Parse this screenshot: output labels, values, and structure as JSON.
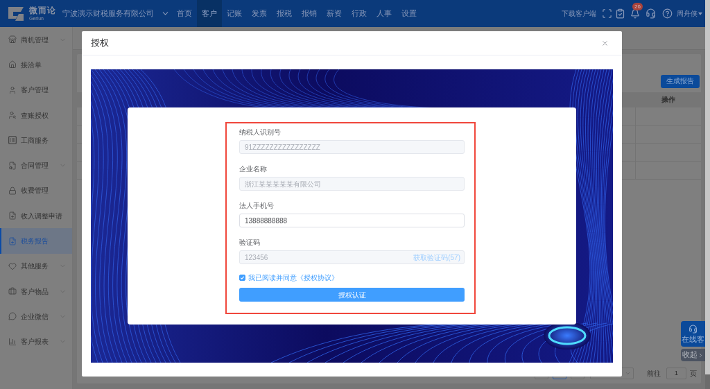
{
  "topbar": {
    "logo": {
      "name": "微而论",
      "subtitle": "Gerlun"
    },
    "company": "宁波演示财税服务有限公司",
    "nav": [
      {
        "label": "首页",
        "selected": false
      },
      {
        "label": "客户",
        "selected": true
      },
      {
        "label": "记账",
        "selected": false
      },
      {
        "label": "发票",
        "selected": false
      },
      {
        "label": "报税",
        "selected": false
      },
      {
        "label": "报销",
        "selected": false
      },
      {
        "label": "薪资",
        "selected": false
      },
      {
        "label": "行政",
        "selected": false
      },
      {
        "label": "人事",
        "selected": false
      },
      {
        "label": "设置",
        "selected": false
      }
    ],
    "download": "下载客户端",
    "notification_count": "26",
    "user": "周舟侠"
  },
  "sidebar": {
    "items": [
      {
        "label": "商机管理",
        "has_children": true,
        "selected": false
      },
      {
        "label": "接洽单",
        "has_children": false,
        "selected": false
      },
      {
        "label": "客户管理",
        "has_children": false,
        "selected": false
      },
      {
        "label": "查账授权",
        "has_children": false,
        "selected": false
      },
      {
        "label": "工商服务",
        "has_children": false,
        "selected": false
      },
      {
        "label": "合同管理",
        "has_children": true,
        "selected": false
      },
      {
        "label": "收费管理",
        "has_children": false,
        "selected": false
      },
      {
        "label": "收入调整申请",
        "has_children": false,
        "selected": false
      },
      {
        "label": "税务报告",
        "has_children": false,
        "selected": true
      },
      {
        "label": "其他服务",
        "has_children": true,
        "selected": false
      },
      {
        "label": "客户物品",
        "has_children": true,
        "selected": false
      },
      {
        "label": "企业微信",
        "has_children": true,
        "selected": false
      },
      {
        "label": "客户报表",
        "has_children": true,
        "selected": false
      }
    ]
  },
  "page": {
    "generate_button": "生成报告",
    "table": {
      "columns": [
        {
          "label": "操作"
        }
      ]
    },
    "pager": {
      "pages": [
        {
          "selected": false
        },
        {
          "selected": true
        },
        {
          "selected": false
        }
      ],
      "goto_label": "前往",
      "goto_value": "1",
      "page_suffix": "页"
    }
  },
  "floating": {
    "service": "在线客",
    "collapse": "收起"
  },
  "modal": {
    "title": "授权",
    "form": {
      "fields": [
        {
          "label": "纳税人识别号",
          "value": "91ZZZZZZZZZZZZZZZZ",
          "disabled": true
        },
        {
          "label": "企业名称",
          "value": "浙江某某某某某有限公司",
          "disabled": true
        },
        {
          "label": "法人手机号",
          "value": "13888888888",
          "disabled": false
        },
        {
          "label": "验证码",
          "value": "123456",
          "disabled": true,
          "action": "获取验证码(57)"
        }
      ],
      "agreement": {
        "checked": true,
        "text": "我已阅读并同意《授权协议》"
      },
      "submit": "授权认证"
    }
  }
}
